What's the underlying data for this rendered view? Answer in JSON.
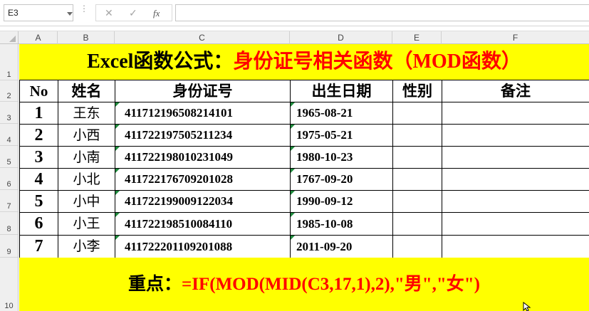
{
  "formula_bar": {
    "name_box": "E3",
    "cancel_icon": "✕",
    "enter_icon": "✓",
    "fx_icon": "fx",
    "formula_value": ""
  },
  "columns": [
    "A",
    "B",
    "C",
    "D",
    "E",
    "F"
  ],
  "rows": [
    "1",
    "2",
    "3",
    "4",
    "5",
    "6",
    "7",
    "8",
    "9",
    "10"
  ],
  "sheet": {
    "title_black": "Excel函数公式：",
    "title_red": "身份证号相关函数（MOD函数）",
    "headers": [
      "No",
      "姓名",
      "身份证号",
      "出生日期",
      "性别",
      "备注"
    ],
    "records": [
      {
        "no": "1",
        "name": "王东",
        "id": "411712196508214101",
        "birth": "1965-08-21",
        "gender": "",
        "note": ""
      },
      {
        "no": "2",
        "name": "小西",
        "id": "411722197505211234",
        "birth": "1975-05-21",
        "gender": "",
        "note": ""
      },
      {
        "no": "3",
        "name": "小南",
        "id": "411722198010231049",
        "birth": "1980-10-23",
        "gender": "",
        "note": ""
      },
      {
        "no": "4",
        "name": "小北",
        "id": "411722176709201028",
        "birth": "1767-09-20",
        "gender": "",
        "note": ""
      },
      {
        "no": "5",
        "name": "小中",
        "id": "411722199009122034",
        "birth": "1990-09-12",
        "gender": "",
        "note": ""
      },
      {
        "no": "6",
        "name": "小王",
        "id": "411722198510084110",
        "birth": "1985-10-08",
        "gender": "",
        "note": ""
      },
      {
        "no": "7",
        "name": "小李",
        "id": "411722201109201088",
        "birth": "2011-09-20",
        "gender": "",
        "note": ""
      }
    ],
    "formula_label": "重点：",
    "formula_text": "=IF(MOD(MID(C3,17,1),2),\"男\",\"女\")"
  },
  "colors": {
    "highlight": "#ffff00",
    "accent_red": "#ff0000",
    "text_marker": "#1e8a3c"
  }
}
